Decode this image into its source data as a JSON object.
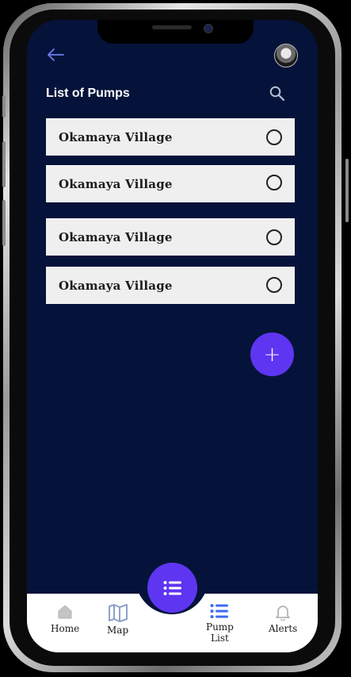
{
  "header": {
    "title": "List of Pumps",
    "back_icon": "arrow-left-icon",
    "search_icon": "search-icon",
    "avatar_icon": "avatar"
  },
  "pumps": [
    {
      "name": "Okamaya Village",
      "selected": false
    },
    {
      "name": "Okamaya Village",
      "selected": false
    },
    {
      "name": "Okamaya Village",
      "selected": false
    },
    {
      "name": "Okamaya Village",
      "selected": false
    }
  ],
  "fab": {
    "label": "+",
    "icon": "plus-icon"
  },
  "bottom_nav": {
    "center_icon": "list-icon",
    "items": [
      {
        "label": "Home",
        "icon": "home-icon"
      },
      {
        "label": "Map",
        "icon": "map-icon"
      },
      {
        "label": "Pump\nList",
        "icon": "list-icon"
      },
      {
        "label": "Alerts",
        "icon": "bell-icon"
      }
    ]
  },
  "colors": {
    "background": "#05133a",
    "accent": "#5e35f1",
    "item_bg": "#efefef",
    "back_icon": "#6f7df2",
    "nav_active": "#3d6bf2",
    "nav_inactive": "#b5b5b5"
  }
}
